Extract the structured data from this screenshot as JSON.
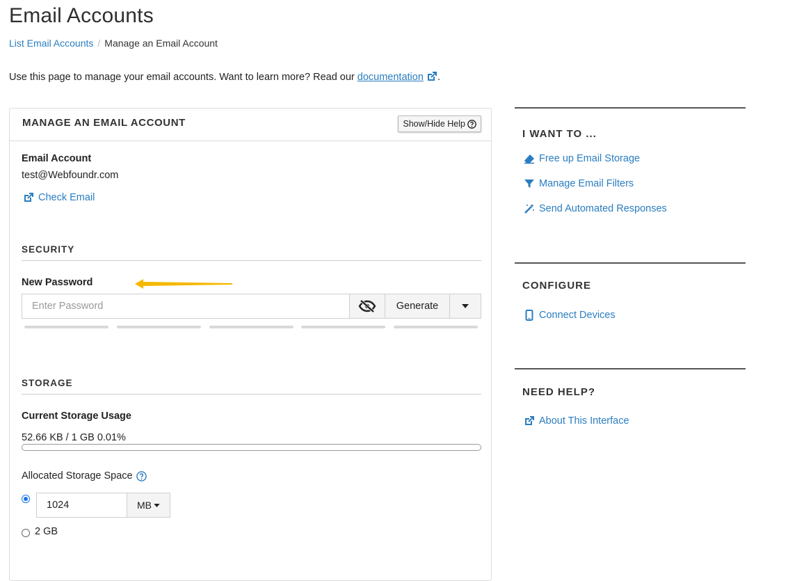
{
  "header": {
    "title": "Email Accounts",
    "breadcrumb": {
      "parent": "List Email Accounts",
      "separator": "/",
      "current": "Manage an Email Account"
    },
    "intro_text": "Use this page to manage your email accounts. Want to learn more? Read our ",
    "intro_link": "documentation",
    "intro_end": "."
  },
  "manage": {
    "title": "MANAGE AN EMAIL ACCOUNT",
    "help_button": "Show/Hide Help",
    "account_label": "Email Account",
    "account_value": "test@Webfoundr.com",
    "check_email": "Check Email"
  },
  "security": {
    "heading": "SECURITY",
    "password_label": "New Password",
    "password_placeholder": "Enter Password",
    "generate_label": "Generate"
  },
  "storage": {
    "heading": "STORAGE",
    "usage_label": "Current Storage Usage",
    "usage_value": "52.66 KB / 1 GB 0.01%",
    "usage_percent": 0.01,
    "allocated_label": "Allocated Storage Space",
    "quota_value": "1024",
    "quota_unit": "MB",
    "option_2gb": "2 GB"
  },
  "sidebar": {
    "i_want_to": {
      "heading": "I WANT TO ...",
      "items": [
        "Free up Email Storage",
        "Manage Email Filters",
        "Send Automated Responses"
      ]
    },
    "configure": {
      "heading": "CONFIGURE",
      "items": [
        "Connect Devices"
      ]
    },
    "need_help": {
      "heading": "NEED HELP?",
      "items": [
        "About This Interface"
      ]
    }
  },
  "colors": {
    "link": "#2a7dc0",
    "accent_arrow": "#f5b800",
    "radio": "#1a73e8"
  },
  "icons": [
    "external-link-icon",
    "question-circle-icon",
    "eye-slash-icon",
    "caret-down-icon",
    "eraser-icon",
    "filter-icon",
    "magic-wand-icon",
    "mobile-icon"
  ]
}
